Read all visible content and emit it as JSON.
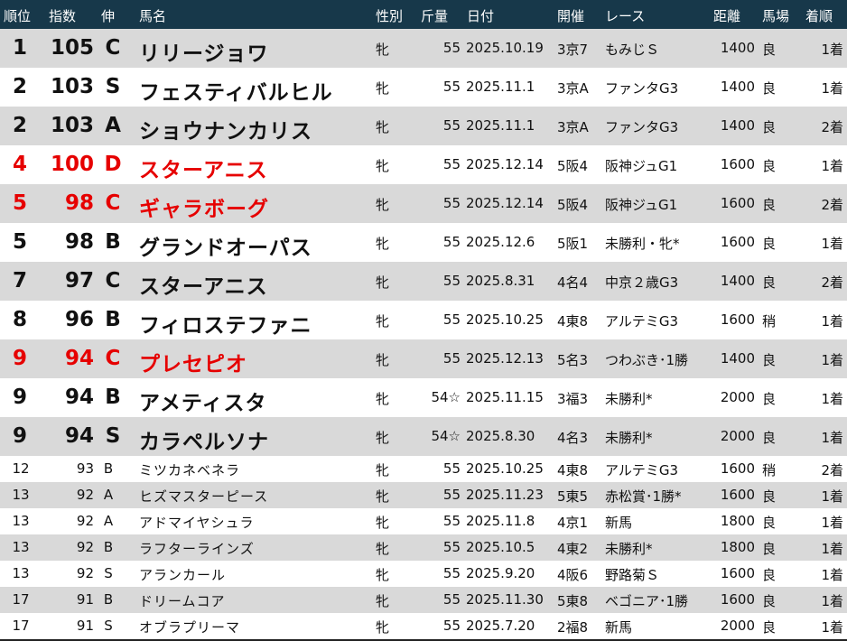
{
  "header": {
    "rank": "順位",
    "index": "指数",
    "nobi": "伸",
    "name": "馬名",
    "sex": "性別",
    "weight": "斤量",
    "date": "日付",
    "kaisai": "開催",
    "race": "レース",
    "distance": "距離",
    "baba": "馬場",
    "finish": "着順"
  },
  "rows": [
    {
      "rank": "1",
      "index": "105",
      "nobi": "C",
      "name": "リリージョワ",
      "sex": "牝",
      "weight": "55",
      "date": "2025.10.19",
      "kaisai": "3京7",
      "race": "もみじＳ",
      "distance": "1400",
      "baba": "良",
      "finish": "1着",
      "size": "big",
      "shade": true,
      "red": false
    },
    {
      "rank": "2",
      "index": "103",
      "nobi": "S",
      "name": "フェスティバルヒル",
      "sex": "牝",
      "weight": "55",
      "date": "2025.11.1",
      "kaisai": "3京A",
      "race": "ファンタG3",
      "distance": "1400",
      "baba": "良",
      "finish": "1着",
      "size": "big",
      "shade": false,
      "red": false
    },
    {
      "rank": "2",
      "index": "103",
      "nobi": "A",
      "name": "ショウナンカリス",
      "sex": "牝",
      "weight": "55",
      "date": "2025.11.1",
      "kaisai": "3京A",
      "race": "ファンタG3",
      "distance": "1400",
      "baba": "良",
      "finish": "2着",
      "size": "big",
      "shade": true,
      "red": false
    },
    {
      "rank": "4",
      "index": "100",
      "nobi": "D",
      "name": "スターアニス",
      "sex": "牝",
      "weight": "55",
      "date": "2025.12.14",
      "kaisai": "5阪4",
      "race": "阪神ジュG1",
      "distance": "1600",
      "baba": "良",
      "finish": "1着",
      "size": "big",
      "shade": false,
      "red": true
    },
    {
      "rank": "5",
      "index": "98",
      "nobi": "C",
      "name": "ギャラボーグ",
      "sex": "牝",
      "weight": "55",
      "date": "2025.12.14",
      "kaisai": "5阪4",
      "race": "阪神ジュG1",
      "distance": "1600",
      "baba": "良",
      "finish": "2着",
      "size": "big",
      "shade": true,
      "red": true
    },
    {
      "rank": "5",
      "index": "98",
      "nobi": "B",
      "name": "グランドオーパス",
      "sex": "牝",
      "weight": "55",
      "date": "2025.12.6",
      "kaisai": "5阪1",
      "race": "未勝利・牝*",
      "distance": "1600",
      "baba": "良",
      "finish": "1着",
      "size": "big",
      "shade": false,
      "red": false
    },
    {
      "rank": "7",
      "index": "97",
      "nobi": "C",
      "name": "スターアニス",
      "sex": "牝",
      "weight": "55",
      "date": "2025.8.31",
      "kaisai": "4名4",
      "race": "中京２歳G3",
      "distance": "1400",
      "baba": "良",
      "finish": "2着",
      "size": "big",
      "shade": true,
      "red": false
    },
    {
      "rank": "8",
      "index": "96",
      "nobi": "B",
      "name": "フィロステファニ",
      "sex": "牝",
      "weight": "55",
      "date": "2025.10.25",
      "kaisai": "4東8",
      "race": "アルテミG3",
      "distance": "1600",
      "baba": "稍",
      "finish": "1着",
      "size": "big",
      "shade": false,
      "red": false
    },
    {
      "rank": "9",
      "index": "94",
      "nobi": "C",
      "name": "プレセピオ",
      "sex": "牝",
      "weight": "55",
      "date": "2025.12.13",
      "kaisai": "5名3",
      "race": "つわぶき･1勝",
      "distance": "1400",
      "baba": "良",
      "finish": "1着",
      "size": "big",
      "shade": true,
      "red": true
    },
    {
      "rank": "9",
      "index": "94",
      "nobi": "B",
      "name": "アメティスタ",
      "sex": "牝",
      "weight": "54☆",
      "date": "2025.11.15",
      "kaisai": "3福3",
      "race": "未勝利*",
      "distance": "2000",
      "baba": "良",
      "finish": "1着",
      "size": "big",
      "shade": false,
      "red": false
    },
    {
      "rank": "9",
      "index": "94",
      "nobi": "S",
      "name": "カラペルソナ",
      "sex": "牝",
      "weight": "54☆",
      "date": "2025.8.30",
      "kaisai": "4名3",
      "race": "未勝利*",
      "distance": "2000",
      "baba": "良",
      "finish": "1着",
      "size": "big",
      "shade": true,
      "red": false
    },
    {
      "rank": "12",
      "index": "93",
      "nobi": "B",
      "name": "ミツカネベネラ",
      "sex": "牝",
      "weight": "55",
      "date": "2025.10.25",
      "kaisai": "4東8",
      "race": "アルテミG3",
      "distance": "1600",
      "baba": "稍",
      "finish": "2着",
      "size": "small",
      "shade": false,
      "red": false
    },
    {
      "rank": "13",
      "index": "92",
      "nobi": "A",
      "name": "ヒズマスターピース",
      "sex": "牝",
      "weight": "55",
      "date": "2025.11.23",
      "kaisai": "5東5",
      "race": "赤松賞･1勝*",
      "distance": "1600",
      "baba": "良",
      "finish": "1着",
      "size": "small",
      "shade": true,
      "red": false
    },
    {
      "rank": "13",
      "index": "92",
      "nobi": "A",
      "name": "アドマイヤシュラ",
      "sex": "牝",
      "weight": "55",
      "date": "2025.11.8",
      "kaisai": "4京1",
      "race": "新馬",
      "distance": "1800",
      "baba": "良",
      "finish": "1着",
      "size": "small",
      "shade": false,
      "red": false
    },
    {
      "rank": "13",
      "index": "92",
      "nobi": "B",
      "name": "ラフターラインズ",
      "sex": "牝",
      "weight": "55",
      "date": "2025.10.5",
      "kaisai": "4東2",
      "race": "未勝利*",
      "distance": "1800",
      "baba": "良",
      "finish": "1着",
      "size": "small",
      "shade": true,
      "red": false
    },
    {
      "rank": "13",
      "index": "92",
      "nobi": "S",
      "name": "アランカール",
      "sex": "牝",
      "weight": "55",
      "date": "2025.9.20",
      "kaisai": "4阪6",
      "race": "野路菊Ｓ",
      "distance": "1600",
      "baba": "良",
      "finish": "1着",
      "size": "small",
      "shade": false,
      "red": false
    },
    {
      "rank": "17",
      "index": "91",
      "nobi": "B",
      "name": "ドリームコア",
      "sex": "牝",
      "weight": "55",
      "date": "2025.11.30",
      "kaisai": "5東8",
      "race": "ベゴニア･1勝",
      "distance": "1600",
      "baba": "良",
      "finish": "1着",
      "size": "small",
      "shade": true,
      "red": false
    },
    {
      "rank": "17",
      "index": "91",
      "nobi": "S",
      "name": "オブラプリーマ",
      "sex": "牝",
      "weight": "55",
      "date": "2025.7.20",
      "kaisai": "2福8",
      "race": "新馬",
      "distance": "2000",
      "baba": "良",
      "finish": "1着",
      "size": "small",
      "shade": false,
      "red": false
    }
  ],
  "colors": {
    "header_bg": "#17384a",
    "shade_bg": "#d9d9d9",
    "highlight": "#e60000"
  }
}
